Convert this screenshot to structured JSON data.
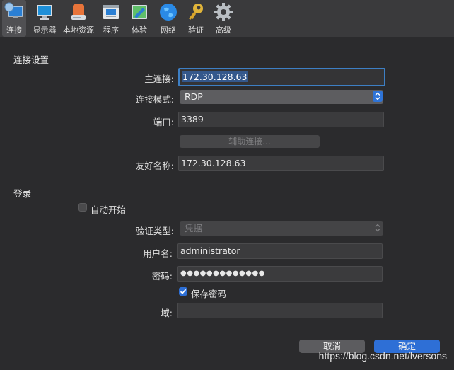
{
  "toolbar": {
    "tabs": [
      {
        "label": "连接",
        "icon": "connect-icon"
      },
      {
        "label": "显示器",
        "icon": "display-icon"
      },
      {
        "label": "本地资源",
        "icon": "local-resources-icon"
      },
      {
        "label": "程序",
        "icon": "programs-icon"
      },
      {
        "label": "体验",
        "icon": "experience-icon"
      },
      {
        "label": "网络",
        "icon": "network-icon"
      },
      {
        "label": "验证",
        "icon": "key-icon"
      },
      {
        "label": "高级",
        "icon": "gear-icon"
      }
    ]
  },
  "connection": {
    "title": "连接设置",
    "host_label": "主连接:",
    "host_value": "172.30.128.63",
    "mode_label": "连接模式:",
    "mode_value": "RDP",
    "port_label": "端口:",
    "port_value": "3389",
    "assist_button": "辅助连接...",
    "friendly_label": "友好名称:",
    "friendly_value": "172.30.128.63"
  },
  "login": {
    "title": "登录",
    "auto_start_label": "自动开始",
    "auto_start_checked": false,
    "auth_label": "验证类型:",
    "auth_value": "凭据",
    "username_label": "用户名:",
    "username_value": "administrator",
    "password_label": "密码:",
    "password_value": "●●●●●●●●●●●●●",
    "save_password_label": "保存密码",
    "save_password_checked": true,
    "domain_label": "域:",
    "domain_value": ""
  },
  "footer": {
    "cancel": "取消",
    "ok": "确定"
  },
  "watermark": "https://blog.csdn.net/lversons",
  "colors": {
    "accent": "#2e6fd6",
    "background": "#2b2b2d"
  }
}
